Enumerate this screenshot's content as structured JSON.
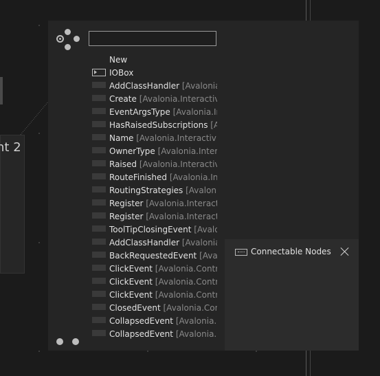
{
  "background_node": {
    "title": "nt 2"
  },
  "search": {
    "value": "",
    "placeholder": ""
  },
  "nodes": [
    {
      "name": "New",
      "ns": "",
      "icon": "none"
    },
    {
      "name": "IOBox",
      "ns": "",
      "icon": "iobox-icon"
    },
    {
      "name": "AddClassHandler",
      "ns": " [Avalonia.Interactivity",
      "icon": "swatch"
    },
    {
      "name": "Create",
      "ns": " [Avalonia.Interactivity.R",
      "icon": "swatch"
    },
    {
      "name": "EventArgsType",
      "ns": " [Avalonia.Interac",
      "icon": "swatch"
    },
    {
      "name": "HasRaisedSubscriptions",
      "ns": " [Avalo",
      "icon": "swatch"
    },
    {
      "name": "Name",
      "ns": " [Avalonia.Interactivity.R",
      "icon": "swatch"
    },
    {
      "name": "OwnerType",
      "ns": " [Avalonia.Interacti",
      "icon": "swatch"
    },
    {
      "name": "Raised",
      "ns": " [Avalonia.Interactivity.R",
      "icon": "swatch"
    },
    {
      "name": "RouteFinished",
      "ns": " [Avalonia.Intera",
      "icon": "swatch"
    },
    {
      "name": "RoutingStrategies",
      "ns": " [Avalonia.In",
      "icon": "swatch"
    },
    {
      "name": "Register",
      "ns": " [Avalonia.Interactivity",
      "icon": "swatch"
    },
    {
      "name": "Register",
      "ns": " [Avalonia.Interactivity",
      "icon": "swatch"
    },
    {
      "name": "ToolTipClosingEvent",
      "ns": " [Avalonia",
      "icon": "swatch"
    },
    {
      "name": "AddClassHandler",
      "ns": " [Avalonia.Int",
      "icon": "swatch"
    },
    {
      "name": "BackRequestedEvent",
      "ns": " [Avalonia",
      "icon": "swatch"
    },
    {
      "name": "ClickEvent",
      "ns": " [Avalonia.Controls.",
      "icon": "swatch"
    },
    {
      "name": "ClickEvent",
      "ns": " [Avalonia.Controls.",
      "icon": "swatch"
    },
    {
      "name": "ClickEvent",
      "ns": " [Avalonia.Controls.",
      "icon": "swatch"
    },
    {
      "name": "ClosedEvent",
      "ns": " [Avalonia.Contro",
      "icon": "swatch"
    },
    {
      "name": "CollapsedEvent",
      "ns": " [Avalonia.Con",
      "icon": "swatch"
    },
    {
      "name": "CollapsedEvent",
      "ns": " [Avalonia.Con",
      "icon": "swatch"
    }
  ],
  "tooltip": {
    "title": "Connectable Nodes"
  },
  "colors": {
    "panel": "#252525",
    "background": "#1b1b1b",
    "namespace_text": "#8a8a8a"
  }
}
